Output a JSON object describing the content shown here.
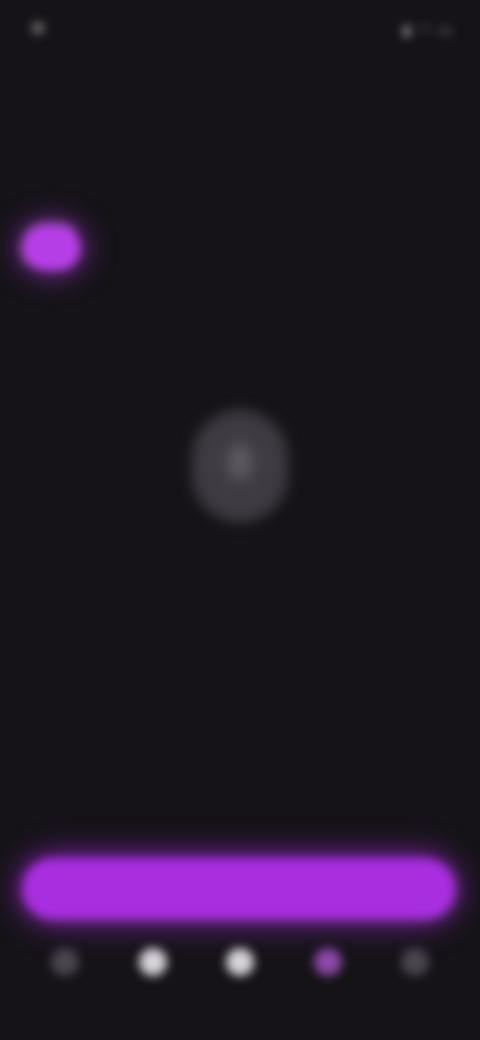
{
  "status_bar": {
    "time": "",
    "icons": [
      "signal-icon",
      "wifi-icon",
      "battery-icon"
    ]
  },
  "header": {
    "title": "",
    "subtitle": ""
  },
  "filter": {
    "chip_label": "",
    "text": ""
  },
  "empty_state": {
    "icon": "microphone-icon",
    "title": "",
    "body": ""
  },
  "primary_action": {
    "label": ""
  },
  "bottom_nav": {
    "items": [
      {
        "icon": "home-icon",
        "label": ""
      },
      {
        "icon": "search-icon",
        "label": ""
      },
      {
        "icon": "library-icon",
        "label": ""
      },
      {
        "icon": "microphone-icon",
        "label": ""
      },
      {
        "icon": "profile-icon",
        "label": ""
      }
    ]
  },
  "colors": {
    "background": "#151317",
    "accent": "#a92ee0",
    "accent_glow": "#b63ee6",
    "muted_text": "#8f8a93"
  }
}
